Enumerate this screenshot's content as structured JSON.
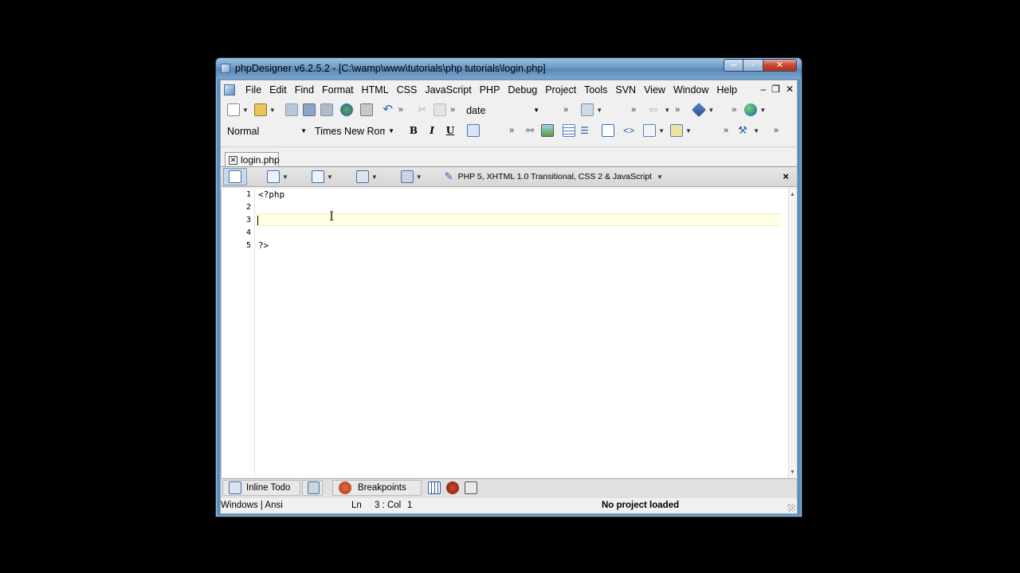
{
  "window": {
    "title": "phpDesigner v6.2.5.2 - [C:\\wamp\\www\\tutorials\\php tutorials\\login.php]",
    "controls": {
      "minimize": "‒",
      "maximize": "▫",
      "close": "✕"
    }
  },
  "menu": {
    "items": [
      "File",
      "Edit",
      "Find",
      "Format",
      "HTML",
      "CSS",
      "JavaScript",
      "PHP",
      "Debug",
      "Project",
      "Tools",
      "SVN",
      "View",
      "Window",
      "Help"
    ],
    "mdi": {
      "minimize": "‒",
      "restore": "❐",
      "close": "✕"
    }
  },
  "toolbar1": {
    "search_value": "date",
    "icons": [
      "new-file-icon",
      "open-folder-icon",
      "save-icon",
      "save-as-icon",
      "save-all-icon",
      "preview-browser-icon",
      "print-icon",
      "undo-icon",
      "cut-icon",
      "copy-icon",
      "insert-function-icon",
      "back-icon",
      "plugin-icon",
      "globe-icon"
    ]
  },
  "toolbar2": {
    "style_value": "Normal",
    "font_value": "Times New Roma",
    "bold": "B",
    "italic": "I",
    "underline": "U",
    "icons": [
      "format-icon",
      "link-icon",
      "image-icon",
      "table-icon",
      "list-icon",
      "box-icon",
      "tag-icon",
      "form-icon",
      "insert-icon",
      "wizard-icon"
    ]
  },
  "tabs": [
    {
      "label": "login.php",
      "close": "✕"
    }
  ],
  "subtoolbar": {
    "language": "PHP 5, XHTML 1.0 Transitional, CSS 2 & JavaScript",
    "close": "×"
  },
  "editor": {
    "line_numbers": [
      "1",
      "2",
      "3",
      "4",
      "5"
    ],
    "lines": [
      "<?php",
      "",
      "",
      "",
      "?>"
    ],
    "current_line": 3
  },
  "bottom_tabs": [
    {
      "label": "Inline Todo",
      "icon": "todo-icon"
    },
    {
      "label": "",
      "icon": "todo-refresh-icon"
    },
    {
      "label": "Breakpoints",
      "icon": "breakpoints-icon"
    }
  ],
  "statusbar": {
    "encoding": "Windows | Ansi",
    "ln_label": "Ln",
    "position": "3 : Col",
    "column": "1",
    "project": "No project loaded"
  },
  "colors": {
    "window_frame": "#5f8fb8",
    "client_bg": "#f0f0f0",
    "current_line": "#ffffe6"
  }
}
